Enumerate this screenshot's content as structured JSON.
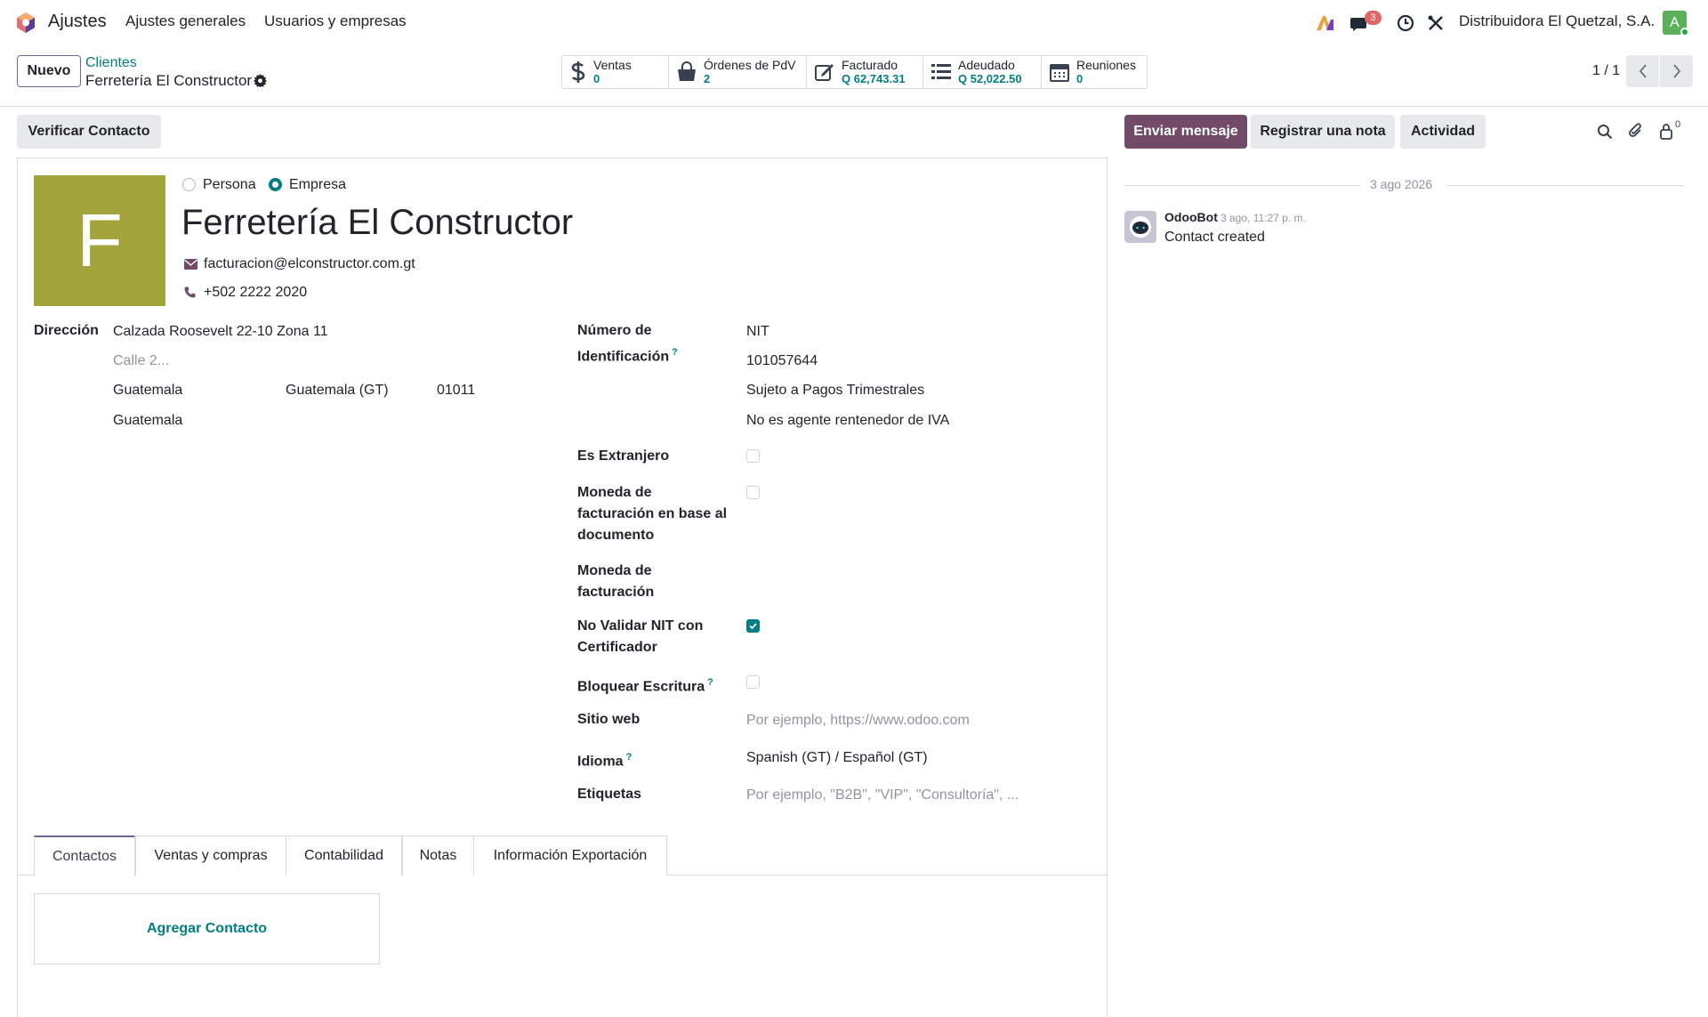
{
  "navbar": {
    "app_name": "Ajustes",
    "menu": [
      "Ajustes generales",
      "Usuarios y empresas"
    ],
    "messages_badge": "3",
    "company": "Distribuidora El Quetzal, S.A.",
    "user_initial": "A"
  },
  "control_panel": {
    "new_button": "Nuevo",
    "breadcrumb_parent": "Clientes",
    "breadcrumb_current": "Ferretería El Constructor",
    "pager": "1 / 1",
    "stats": [
      {
        "label": "Ventas",
        "value": "0",
        "icon": "dollar-icon"
      },
      {
        "label": "Órdenes de PdV",
        "value": "2",
        "icon": "shopping-bag-icon"
      },
      {
        "label": "Facturado",
        "value": "Q 62,743.31",
        "icon": "edit-invoice-icon"
      },
      {
        "label": "Adeudado",
        "value": "Q 52,022.50",
        "icon": "list-icon"
      },
      {
        "label": "Reuniones",
        "value": "0",
        "icon": "calendar-icon"
      }
    ]
  },
  "actions": {
    "verify": "Verificar Contacto",
    "send_message": "Enviar mensaje",
    "log_note": "Registrar una nota",
    "activity": "Actividad",
    "followers_count": "0"
  },
  "form": {
    "avatar_letter": "F",
    "type_person": "Persona",
    "type_company": "Empresa",
    "type_selected": "Empresa",
    "name": "Ferretería El Constructor",
    "email": "facturacion@elconstructor.com.gt",
    "phone": "+502 2222 2020",
    "address_label": "Dirección",
    "street": "Calzada Roosevelt 22-10 Zona 11",
    "street2_placeholder": "Calle 2...",
    "city": "Guatemala",
    "state": "Guatemala (GT)",
    "zip": "01011",
    "country": "Guatemala",
    "id_label_1": "Número de",
    "id_label_2": "Identificación",
    "id_type": "NIT",
    "id_number": "101057644",
    "tax_regime": "Sujeto a Pagos Trimestrales",
    "iva_agent": "No es agente rentenedor de IVA",
    "foreign_label": "Es Extranjero",
    "doc_currency_label_1": "Moneda de",
    "doc_currency_label_2": "facturación en base al",
    "doc_currency_label_3": "documento",
    "currency_label_1": "Moneda de",
    "currency_label_2": "facturación",
    "no_validate_label_1": "No Validar NIT con",
    "no_validate_label_2": "Certificador",
    "lock_label": "Bloquear Escritura",
    "website_label": "Sitio web",
    "website_placeholder": "Por ejemplo, https://www.odoo.com",
    "lang_label": "Idioma",
    "lang_value": "Spanish (GT) / Español (GT)",
    "tags_label": "Etiquetas",
    "tags_placeholder": "Por ejemplo, \"B2B\", \"VIP\", \"Consultoría\", ...",
    "help_mark": "?"
  },
  "tabs": [
    "Contactos",
    "Ventas y compras",
    "Contabilidad",
    "Notas",
    "Información Exportación"
  ],
  "add_contact": "Agregar Contacto",
  "chatter": {
    "date": "3 ago 2026",
    "author": "OdooBot",
    "time": "3 ago, 11:27 p. m.",
    "message": "Contact created"
  },
  "colors": {
    "brand": "#714b67",
    "accent": "#017e84",
    "avatar": "#a3a43b"
  }
}
